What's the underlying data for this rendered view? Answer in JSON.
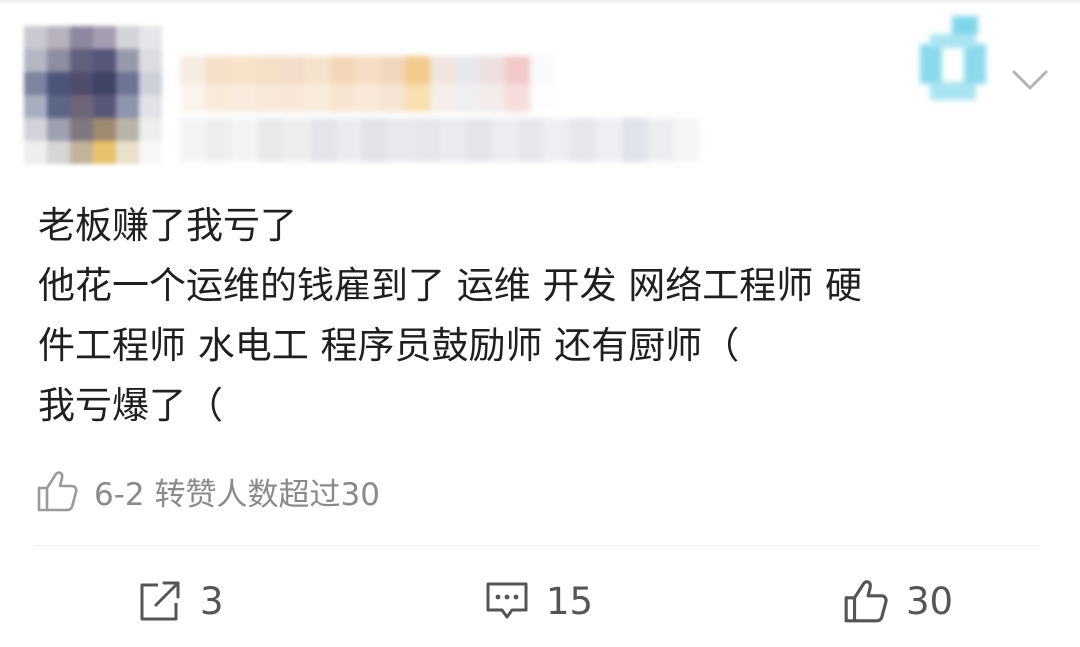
{
  "post": {
    "lines": [
      "老板赚了我亏了",
      "他花一个运维的钱雇到了 运维 开发 网络工程师 硬",
      "件工程师 水电工 程序员鼓励师 还有厨师（",
      "我亏爆了（"
    ]
  },
  "retweet_info": {
    "text": "6-2 转赞人数超过30",
    "icon": "thumbs-up-icon"
  },
  "actions": {
    "repost": {
      "icon": "share-icon",
      "count": "3"
    },
    "comment": {
      "icon": "comment-icon",
      "count": "15"
    },
    "like": {
      "icon": "thumbs-up-icon",
      "count": "30"
    }
  },
  "header": {
    "menu_icon": "chevron-down-icon"
  },
  "colors": {
    "text": "#1f1f1f",
    "muted": "#8a8a8a",
    "action_text": "#555555",
    "divider": "#ededed",
    "badge": "#7fd6ea"
  }
}
